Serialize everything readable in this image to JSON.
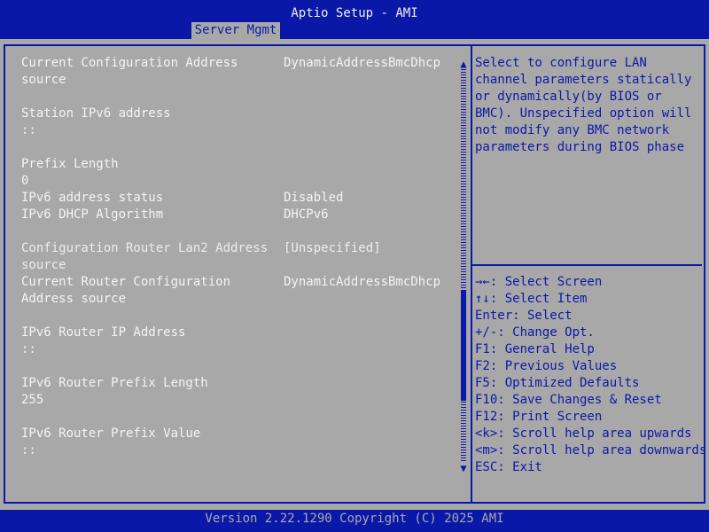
{
  "title": "Aptio Setup - AMI",
  "tab": "Server Mgmt",
  "items": [
    {
      "label": "Current Configuration Address source",
      "value": "DynamicAddressBmcDhcp"
    },
    {
      "label": "Station IPv6 address",
      "sub": "::"
    },
    {
      "label": "Prefix Length",
      "sub": "0"
    },
    {
      "label": "IPv6 address status",
      "value": "Disabled"
    },
    {
      "label": "IPv6 DHCP Algorithm",
      "value": "DHCPv6"
    },
    {
      "label": "Configuration Router Lan2 Address source",
      "value": "[Unspecified]"
    },
    {
      "label": "Current Router Configuration Address source",
      "value": "DynamicAddressBmcDhcp"
    },
    {
      "label": "IPv6 Router IP Address",
      "sub": "::"
    },
    {
      "label": "IPv6 Router Prefix Length",
      "sub": "255"
    },
    {
      "label": "IPv6 Router Prefix Value",
      "sub": "::"
    }
  ],
  "help": "Select to configure LAN channel parameters statically or dynamically(by BIOS or BMC). Unspecified option will not modify any BMC network parameters during BIOS phase",
  "keys": [
    "→←: Select Screen",
    "↑↓: Select Item",
    "Enter: Select",
    "+/-: Change Opt.",
    "F1: General Help",
    "F2: Previous Values",
    "F5: Optimized Defaults",
    "F10: Save Changes & Reset",
    "F12: Print Screen",
    "<k>: Scroll help area upwards",
    "<m>: Scroll help area downwards",
    "ESC: Exit"
  ],
  "scroll": {
    "position": 0.78,
    "thumb_fraction": 0.28
  },
  "footer": "Version 2.22.1290 Copyright (C) 2025 AMI",
  "colors": {
    "background": "#a8a8a8",
    "accent": "#0a18a8",
    "text": "#f4f4f4"
  }
}
